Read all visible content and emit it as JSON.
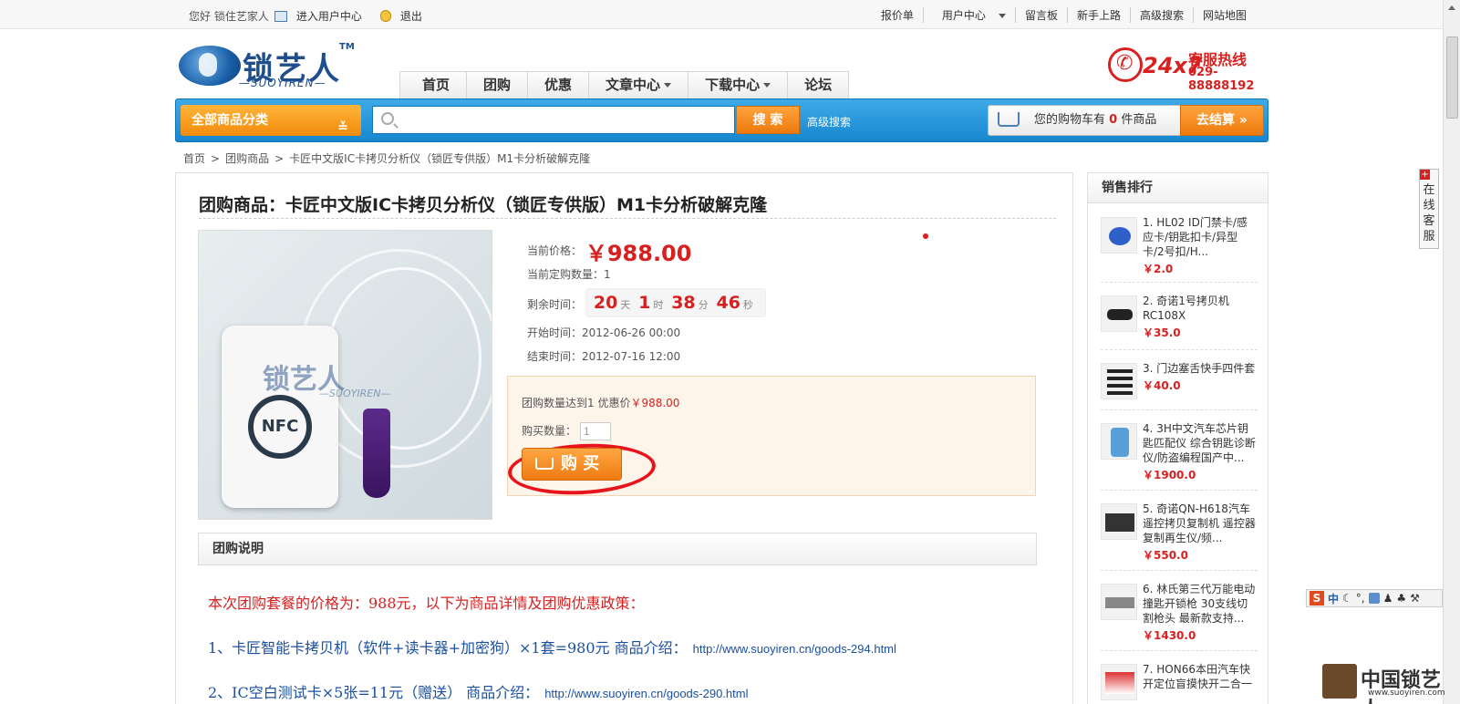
{
  "topbar": {
    "greeting": "您好 锁住艺家人",
    "user_center_link": "进入用户中心",
    "logout": "退出",
    "right_links": [
      "报价单",
      "用户中心",
      "留言板",
      "新手上路",
      "高级搜索",
      "网站地图"
    ]
  },
  "logo": {
    "name": "锁艺人",
    "tm": "TM",
    "sub": "—SUOYIREN—"
  },
  "nav": [
    "首页",
    "团购",
    "优惠",
    "文章中心",
    "下载中心",
    "论坛"
  ],
  "hotline": {
    "label247": "24x7",
    "title": "客服热线",
    "number": "029-88888192"
  },
  "searchbar": {
    "all_categories": "全部商品分类",
    "search_button": "搜 索",
    "advanced": "高级搜索",
    "cart_prefix": "您的购物车有",
    "cart_count": "0",
    "cart_suffix": "件商品",
    "checkout": "去结算 »"
  },
  "breadcrumb": [
    "首页",
    "团购商品",
    "卡匠中文版IC卡拷贝分析仪（锁匠专供版）M1卡分析破解克隆"
  ],
  "product": {
    "title": "团购商品：卡匠中文版IC卡拷贝分析仪（锁匠专供版）M1卡分析破解克隆",
    "image_watermark": "锁艺人",
    "image_watermark_sub": "—SUOYIREN—",
    "image_nfc": "NFC",
    "current_price_label": "当前价格：",
    "current_price": "￥988.00",
    "ordered_label": "当前定购数量：",
    "ordered": "1",
    "remaining_label": "剩余时间：",
    "countdown": {
      "days": "20",
      "days_unit": "天",
      "hours": "1",
      "hours_unit": "时",
      "minutes": "38",
      "minutes_unit": "分",
      "seconds": "46",
      "seconds_unit": "秒"
    },
    "start_label": "开始时间：",
    "start": "2012-06-26 00:00",
    "end_label": "结束时间：",
    "end": "2012-07-16 12:00",
    "offer_prefix": "团购数量达到1 优惠价",
    "offer_price": "￥988.00",
    "qty_label": "购买数量：",
    "qty": "1",
    "buy_button": "购 买"
  },
  "description": {
    "header": "团购说明",
    "line1": "本次团购套餐的价格为：988元，以下为商品详情及团购优惠政策：",
    "line2": "1、卡匠智能卡拷贝机（软件+读卡器+加密狗）×1套=980元  商品介绍：",
    "line2_url": "http://www.suoyiren.cn/goods-294.html",
    "line3": "2、IC空白测试卡×5张=11元（赠送）  商品介绍：",
    "line3_url": "http://www.suoyiren.cn/goods-290.html"
  },
  "sidebar": {
    "title": "销售排行",
    "items": [
      {
        "title": "1. HL02 ID门禁卡/感应卡/钥匙扣卡/异型卡/2号扣/H...",
        "price": "￥2.0"
      },
      {
        "title": "2. 奇诺1号拷贝机RC108X",
        "price": "￥35.0"
      },
      {
        "title": "3. 门边塞舌快手四件套",
        "price": "￥40.0"
      },
      {
        "title": "4. 3H中文汽车芯片钥匙匹配仪 综合钥匙诊断仪/防盗编程国产中...",
        "price": "￥1900.0"
      },
      {
        "title": "5. 奇诺QN-H618汽车遥控拷贝复制机 遥控器复制再生仪/频...",
        "price": "￥550.0"
      },
      {
        "title": "6. 林氏第三代万能电动撞匙开锁枪 30支线切割枪头 最新款支持...",
        "price": "￥1430.0"
      },
      {
        "title": "7. HON66本田汽车快开定位盲摸快开二合一",
        "price": ""
      }
    ]
  },
  "service_tab": "在线客服",
  "ime": {
    "s": "S",
    "zh": "中"
  },
  "footer_watermark": {
    "title": "中国锁艺人",
    "url": "www.suoyiren.com"
  },
  "colors": {
    "accent_red": "#d82020",
    "brand_blue": "#1687cf",
    "orange": "#ef7b10"
  }
}
